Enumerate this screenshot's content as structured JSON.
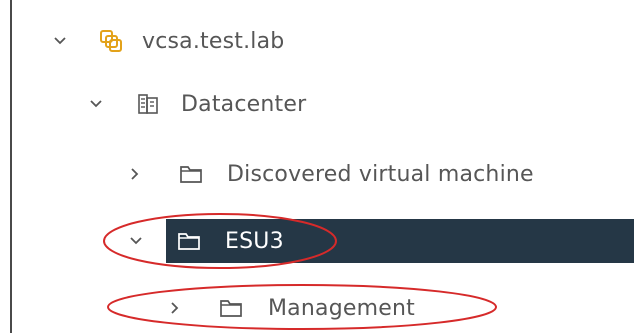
{
  "tree": {
    "nodes": [
      {
        "label": "vcsa.test.lab",
        "expanded": true,
        "icon": "vcenter-icon"
      },
      {
        "label": "Datacenter",
        "expanded": true,
        "icon": "datacenter-icon"
      },
      {
        "label": "Discovered virtual machine",
        "expanded": false,
        "icon": "folder-icon"
      },
      {
        "label": "ESU3",
        "expanded": true,
        "icon": "folder-icon",
        "selected": true
      },
      {
        "label": "Management",
        "expanded": false,
        "icon": "folder-icon"
      }
    ]
  },
  "colors": {
    "selected_background": "#253746",
    "selected_text": "#ffffff",
    "text": "#565656",
    "vcenter_icon": "#e3a21a",
    "annotation": "#d62a2a"
  }
}
